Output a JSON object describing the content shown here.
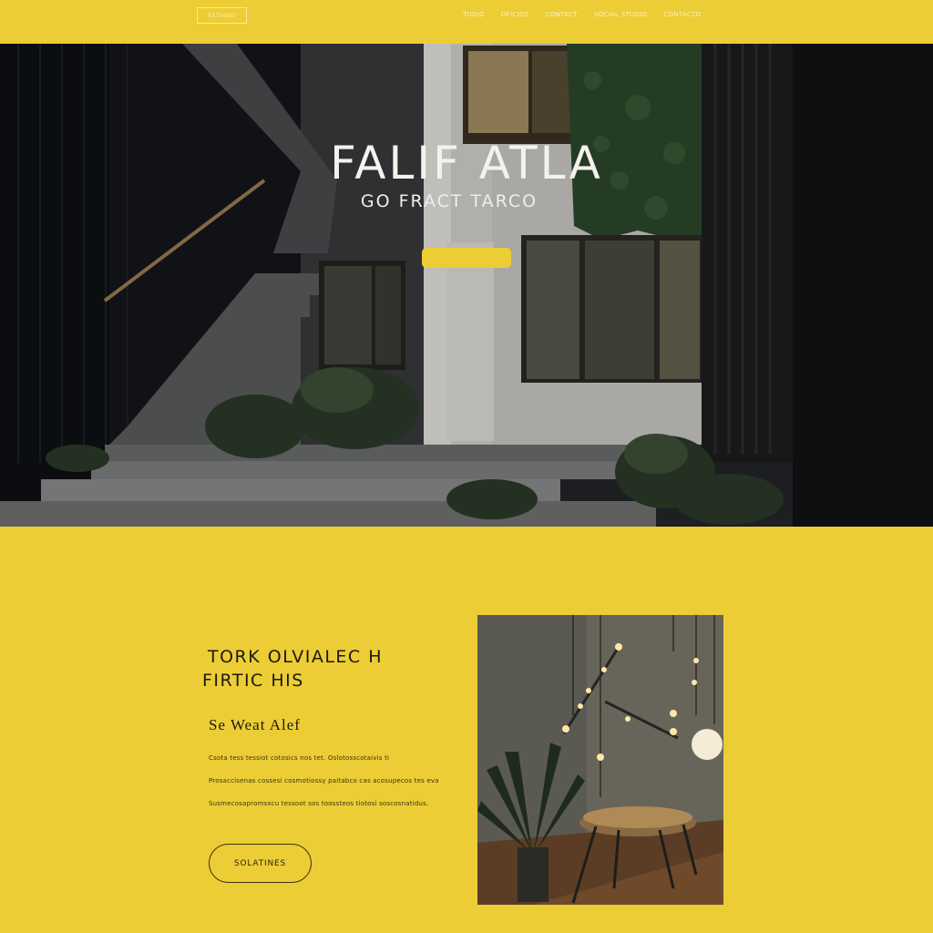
{
  "header": {
    "logo": "ESTUDIO",
    "nav": [
      {
        "label": "TUDIO"
      },
      {
        "label": "OFICIOS"
      },
      {
        "label": "CONTACT"
      },
      {
        "label": "SOCIAL STUDIO"
      },
      {
        "label": "CONTACTO"
      }
    ]
  },
  "hero": {
    "title": "FALIF ATLA",
    "subtitle": "GO FRACT TARCO"
  },
  "feature": {
    "heading_line1": "TORK OLVIALEC H",
    "heading_line2": "FIRTIC HIS",
    "subheading": "Se Weat Alef",
    "body": [
      "Csota tess tessiot cotosics nos tet. Oslotosscotaivis ti",
      "Prosaccisenas cossesi cosmotiossy paitabco cas acosupecos tes eva",
      "Susmecosapromsxcu tessoot sos toossteos tiotosi soscosnatidus."
    ],
    "button": "SOLATINES"
  },
  "colors": {
    "accent": "#eccd35",
    "ink": "#1b1a12"
  }
}
